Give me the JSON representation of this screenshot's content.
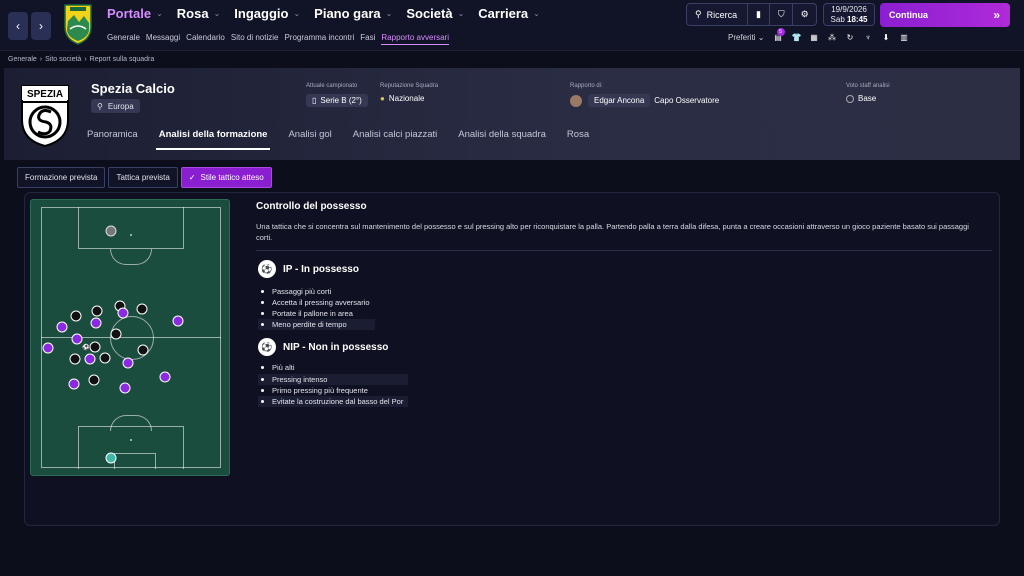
{
  "nav": {
    "menu": [
      {
        "label": "Portale",
        "active": true
      },
      {
        "label": "Rosa",
        "active": false
      },
      {
        "label": "Ingaggio",
        "active": false
      },
      {
        "label": "Piano gara",
        "active": false
      },
      {
        "label": "Società",
        "active": false
      },
      {
        "label": "Carriera",
        "active": false
      }
    ],
    "submenu": [
      "Generale",
      "Messaggi",
      "Calendario",
      "Sito di notizie",
      "Programma incontri",
      "Fasi",
      "Rapporto avversari"
    ],
    "search_label": "Ricerca",
    "date": "19/9/2026",
    "day": "Sab",
    "time": "18:45",
    "continue_label": "Continua",
    "prefs_label": "Preferiti",
    "notif_count": "5"
  },
  "breadcrumb": [
    "Generale",
    "Sito società",
    "Report sulla squadra"
  ],
  "club": {
    "name": "Spezia Calcio",
    "region": "Europa",
    "league_label": "Attuale campionato",
    "league": "Serie B (2°)",
    "rep_label": "Reputazione Squadra",
    "rep": "Nazionale",
    "report_label": "Rapporto di:",
    "scout_name": "Edgar Ancona",
    "scout_role": "Capo Osservatore",
    "vote_label": "Voto staff analisi",
    "vote": "Base",
    "tabs": [
      "Panoramica",
      "Analisi della formazione",
      "Analisi gol",
      "Analisi calci piazzati",
      "Analisi della squadra",
      "Rosa"
    ],
    "active_tab": 1
  },
  "subtabs": [
    "Formazione prevista",
    "Tattica prevista",
    "Stile tattico atteso"
  ],
  "colors": {
    "accent": "#8a1fd1",
    "pitch": "#1b4d3e",
    "home": "#111111",
    "away": "#8a2be2"
  },
  "style": {
    "title": "Controllo del possesso",
    "description": "Una tattica che si concentra sul mantenimento del possesso e sul pressing alto per riconquistare la palla. Partendo palla a terra dalla difesa, punta a creare occasioni attraverso un gioco paziente basato sui passaggi corti.",
    "in_possession_title": "IP - In possesso",
    "in_possession": [
      "Passaggi più corti",
      "Accetta il pressing avversario",
      "Portate il pallone in area",
      "Meno perdite di tempo"
    ],
    "out_possession_title": "NIP - Non in possesso",
    "out_possession": [
      "Più alti",
      "Pressing intenso",
      "Primo pressing più frequente",
      "Evitate la costruzione dal basso del Por"
    ]
  }
}
